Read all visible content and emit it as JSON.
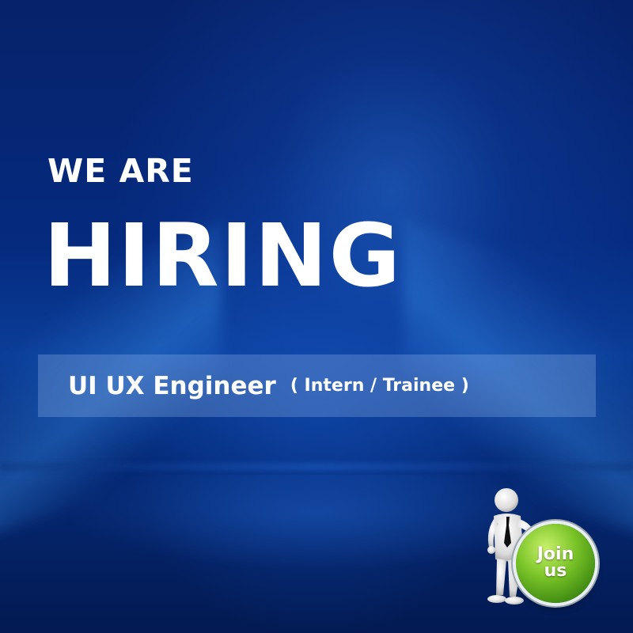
{
  "headline": {
    "line1": "WE ARE",
    "line2": "HIRING"
  },
  "position": {
    "title": "UI UX Engineer",
    "type": "( Intern / Trainee )"
  },
  "cta": {
    "label": "Join us",
    "icon": "person-leaning-icon"
  },
  "colors": {
    "background": "#052a7e",
    "text": "#ffffff",
    "button": "#6ab823"
  }
}
